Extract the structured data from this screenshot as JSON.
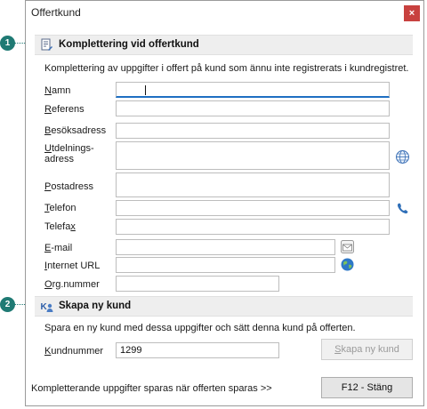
{
  "window": {
    "title": "Offertkund",
    "close_symbol": "×"
  },
  "callouts": [
    "1",
    "2"
  ],
  "section_completion": {
    "title": "Komplettering vid offertkund",
    "description": "Komplettering av uppgifter i offert på kund som ännu inte registrerats i kundregistret."
  },
  "fields": {
    "namn": {
      "label_key": "N",
      "label_rest": "amn",
      "value": ""
    },
    "referens": {
      "label_key": "R",
      "label_rest": "eferens",
      "value": ""
    },
    "besoksadress": {
      "label_key": "B",
      "label_rest": "esöksadress",
      "value": ""
    },
    "utdelningsadress": {
      "label_key": "U",
      "label_rest": "tdelnings-",
      "label_line2": "adress",
      "value": ""
    },
    "postadress": {
      "label_key": "P",
      "label_rest": "ostadress",
      "value": ""
    },
    "telefon": {
      "label_key": "T",
      "label_rest": "elefon",
      "value": ""
    },
    "telefax": {
      "label_pre": "Telefa",
      "label_key": "x",
      "value": ""
    },
    "email": {
      "label_key": "E",
      "label_rest": "-mail",
      "value": ""
    },
    "internet_url": {
      "label_key": "I",
      "label_rest": "nternet URL",
      "value": ""
    },
    "org_nummer": {
      "label_key": "O",
      "label_rest": "rg.nummer",
      "value": ""
    }
  },
  "icons": {
    "section1": "customer-form-icon",
    "section2": "add-customer-icon",
    "address_lookup": "globe-icon",
    "dial": "phone-icon",
    "email": "envelope-icon",
    "url": "web-globe-icon"
  },
  "section_new_customer": {
    "title": "Skapa ny kund",
    "description": "Spara en ny kund med dessa uppgifter och sätt denna kund på offerten.",
    "kundnummer": {
      "label_key": "K",
      "label_rest": "undnummer",
      "value": "1299"
    },
    "create_button": {
      "label_key": "S",
      "label_rest": "kapa ny kund"
    }
  },
  "footer": {
    "info_text": "Kompletterande uppgifter sparas när offerten sparas >>",
    "close_button_label": "F12 - Stäng"
  }
}
